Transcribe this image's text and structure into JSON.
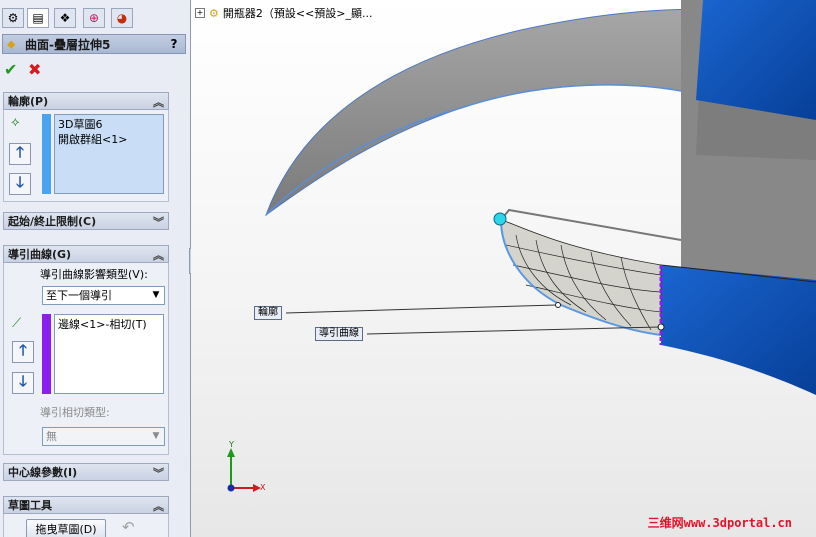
{
  "feature": {
    "title": "曲面-疊層拉伸5",
    "help": "?",
    "ok_icon": "checkmark-icon",
    "cancel_icon": "cross-icon"
  },
  "tabs": [
    {
      "icon": "feature-manager-icon",
      "glyph": "⚙"
    },
    {
      "icon": "property-manager-icon",
      "glyph": "▤"
    },
    {
      "icon": "configuration-manager-icon",
      "glyph": "❖"
    },
    {
      "icon": "dimxpert-icon",
      "glyph": "⊕"
    },
    {
      "icon": "display-manager-icon",
      "glyph": "◕"
    }
  ],
  "profile_group": {
    "header": "輪廓(P)",
    "items": [
      "3D草圖6",
      "開啟群組<1>"
    ],
    "color": "#4aa3f0"
  },
  "start_end_group": {
    "header": "起始/終止限制(C)"
  },
  "guide_group": {
    "header": "導引曲線(G)",
    "influence_label": "導引曲線影響類型(V):",
    "influence_value": "至下一個導引",
    "items": [
      "邊線<1>-相切(T)"
    ],
    "color": "#8a1df0",
    "tangency_label": "導引相切類型:",
    "tangency_value": "無"
  },
  "centerline_group": {
    "header": "中心線參數(I)"
  },
  "sketch_tools_group": {
    "header": "草圖工具",
    "drag_button": "拖曳草圖(D)"
  },
  "viewport": {
    "tree_label": "開瓶器2（預設<<預設>_顯...",
    "callout_profile": "輪廓",
    "callout_guide": "導引曲線",
    "axis_x": "X",
    "axis_y": "Y",
    "watermark": "三维网www.3dportal.cn"
  },
  "colors": {
    "accent_blue": "#0a4fb0",
    "surface_gray": "#9c9c9c",
    "profile_color": "#4aa3f0",
    "guide_color": "#8a1df0"
  }
}
